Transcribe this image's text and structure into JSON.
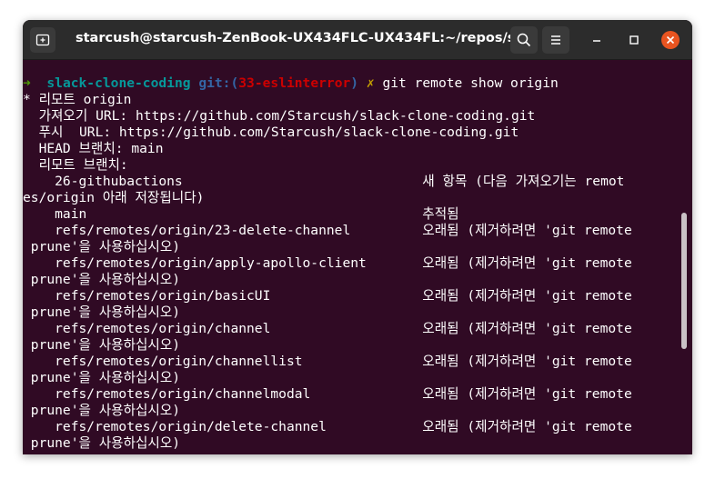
{
  "window": {
    "title": "starcush@starcush-ZenBook-UX434FLC-UX434FL:~/repos/slack-..."
  },
  "prompt": {
    "arrow": "➜",
    "dir": "slack-clone-coding",
    "git_label": "git:(",
    "branch": "33-eslinterror",
    "git_close": ")",
    "dirty_mark": "✗",
    "command": "git remote show origin"
  },
  "output": {
    "remote_header": "* 리모트 origin",
    "fetch_url": "  가져오기 URL: https://github.com/Starcush/slack-clone-coding.git",
    "push_url": "  푸시  URL: https://github.com/Starcush/slack-clone-coding.git",
    "head_branch": "  HEAD 브랜치: main",
    "remote_branches": "  리모트 브랜치:",
    "rows": [
      "    26-githubactions                              새 항목 (다음 가져오기는 remot",
      "es/origin 아래 저장됩니다)",
      "    main                                          추적됨",
      "    refs/remotes/origin/23-delete-channel         오래됨 (제거하려면 'git remote",
      " prune'을 사용하십시오)",
      "    refs/remotes/origin/apply-apollo-client       오래됨 (제거하려면 'git remote",
      " prune'을 사용하십시오)",
      "    refs/remotes/origin/basicUI                   오래됨 (제거하려면 'git remote",
      " prune'을 사용하십시오)",
      "    refs/remotes/origin/channel                   오래됨 (제거하려면 'git remote",
      " prune'을 사용하십시오)",
      "    refs/remotes/origin/channellist               오래됨 (제거하려면 'git remote",
      " prune'을 사용하십시오)",
      "    refs/remotes/origin/channelmodal              오래됨 (제거하려면 'git remote",
      " prune'을 사용하십시오)",
      "    refs/remotes/origin/delete-channel            오래됨 (제거하려면 'git remote",
      " prune'을 사용하십시오)"
    ]
  },
  "colors": {
    "terminal_bg": "#300a24",
    "titlebar_bg": "#2c2c2c",
    "close_button": "#e95420",
    "prompt_arrow": "#4e9a06",
    "prompt_dir": "#06989a",
    "prompt_git": "#3465a4",
    "prompt_branch": "#cc0000",
    "prompt_dirty": "#c4a000"
  },
  "icons": {
    "new_tab": "new-tab-icon",
    "search": "search-icon",
    "menu": "hamburger-menu-icon",
    "minimize": "minimize-icon",
    "maximize": "maximize-icon",
    "close": "close-icon"
  }
}
